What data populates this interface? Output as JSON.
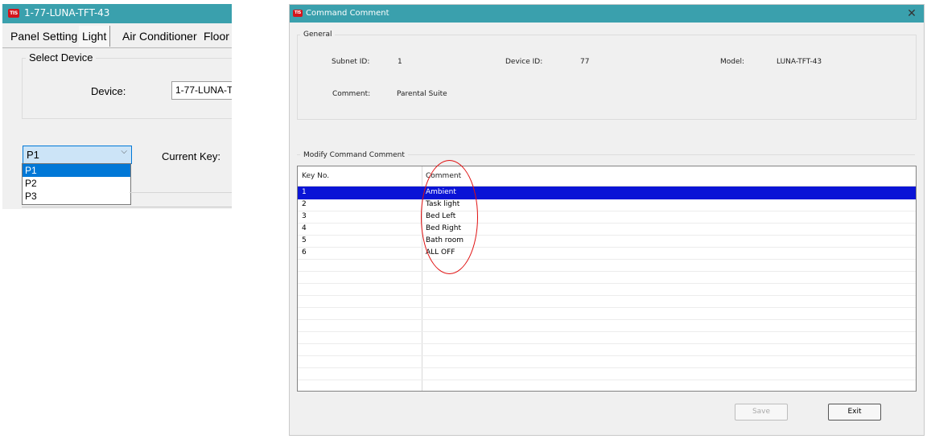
{
  "left_window": {
    "title": "1-77-LUNA-TFT-43",
    "app_icon_text": "TIS",
    "tabs": [
      "Panel Setting",
      "Light",
      "Air Conditioner",
      "Floor"
    ],
    "active_tab": "Light",
    "select_device": {
      "group_label": "Select Device",
      "device_label": "Device:",
      "device_value": "1-77-LUNA-T"
    },
    "panel_combo": {
      "selected": "P1",
      "options": [
        "P1",
        "P2",
        "P3"
      ],
      "highlighted_option": "P1"
    },
    "current_key_label": "Current Key:"
  },
  "dialog": {
    "title": "Command Comment",
    "app_icon_text": "TIS",
    "close_symbol": "✕",
    "general": {
      "group_label": "General",
      "subnet_id_label": "Subnet ID:",
      "subnet_id_value": "1",
      "device_id_label": "Device ID:",
      "device_id_value": "77",
      "model_label": "Model:",
      "model_value": "LUNA-TFT-43",
      "comment_label": "Comment:",
      "comment_value": "Parental Suite"
    },
    "modify": {
      "group_label": "Modify Command Comment",
      "columns": [
        "Key No.",
        "Comment"
      ],
      "rows": [
        {
          "key": "1",
          "comment": "Ambient"
        },
        {
          "key": "2",
          "comment": "Task light"
        },
        {
          "key": "3",
          "comment": "Bed Left"
        },
        {
          "key": "4",
          "comment": "Bed Right"
        },
        {
          "key": "5",
          "comment": "Bath room"
        },
        {
          "key": "6",
          "comment": "ALL OFF"
        }
      ],
      "selected_row_key": "1"
    },
    "buttons": {
      "save": "Save",
      "exit": "Exit"
    }
  },
  "colors": {
    "titlebar": "#3aa0ad",
    "selection": "#0a14d6",
    "annotation": "#e01010"
  }
}
